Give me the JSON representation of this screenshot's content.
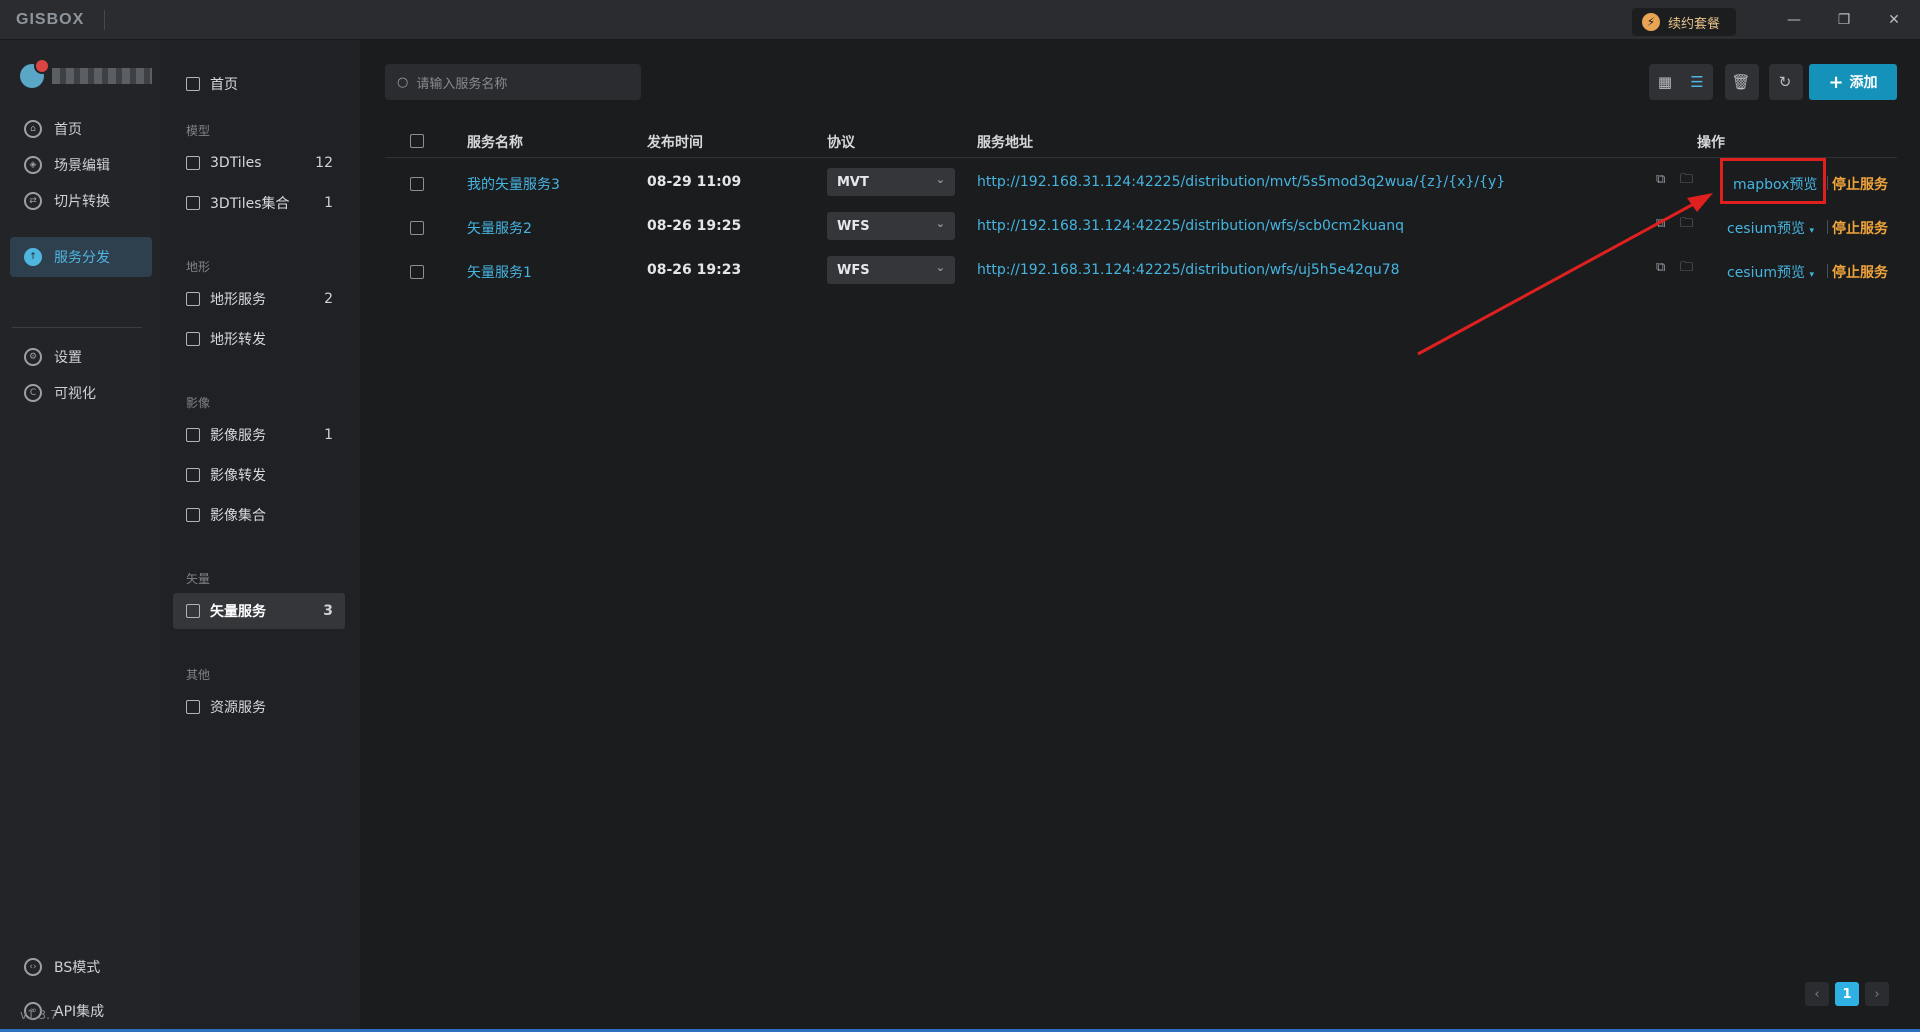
{
  "app": {
    "logo": "GISBOX",
    "renew": "续约套餐",
    "version": "v1.3.7"
  },
  "left_nav": {
    "items": [
      {
        "label": "首页",
        "icon": "home-icon"
      },
      {
        "label": "场景编辑",
        "icon": "cube-icon"
      },
      {
        "label": "切片转换",
        "icon": "swap-icon"
      },
      {
        "label": "服务分发",
        "icon": "upload-icon"
      },
      {
        "label": "设置",
        "icon": "gear-icon"
      },
      {
        "label": "可视化",
        "icon": "chart-icon"
      },
      {
        "label": "BS模式",
        "icon": "code-icon"
      },
      {
        "label": "API集成",
        "icon": "link-icon"
      }
    ]
  },
  "sub_nav": {
    "home": "首页",
    "groups": [
      "模型",
      "地形",
      "影像",
      "矢量",
      "其他"
    ],
    "items": [
      {
        "label": "3DTiles",
        "count": "12"
      },
      {
        "label": "3DTiles集合",
        "count": "1"
      },
      {
        "label": "地形服务",
        "count": "2"
      },
      {
        "label": "地形转发",
        "count": ""
      },
      {
        "label": "影像服务",
        "count": "1"
      },
      {
        "label": "影像转发",
        "count": ""
      },
      {
        "label": "影像集合",
        "count": ""
      },
      {
        "label": "矢量服务",
        "count": "3"
      },
      {
        "label": "资源服务",
        "count": ""
      }
    ]
  },
  "toolbar": {
    "search_placeholder": "请输入服务名称",
    "add_label": "添加"
  },
  "table": {
    "headers": {
      "name": "服务名称",
      "time": "发布时间",
      "protocol": "协议",
      "url": "服务地址",
      "actions": "操作"
    },
    "rows": [
      {
        "name": "我的矢量服务3",
        "time": "08-29 11:09",
        "protocol": "MVT",
        "url": "http://192.168.31.124:42225/distribution/mvt/5s5mod3q2wua/{z}/{x}/{y}",
        "preview": "mapbox预览",
        "stop": "停止服务"
      },
      {
        "name": "矢量服务2",
        "time": "08-26 19:25",
        "protocol": "WFS",
        "url": "http://192.168.31.124:42225/distribution/wfs/scb0cm2kuanq",
        "preview": "cesium预览",
        "stop": "停止服务"
      },
      {
        "name": "矢量服务1",
        "time": "08-26 19:23",
        "protocol": "WFS",
        "url": "http://192.168.31.124:42225/distribution/wfs/uj5h5e42qu78",
        "preview": "cesium预览",
        "stop": "停止服务"
      }
    ]
  },
  "pagination": {
    "current": "1"
  },
  "colors": {
    "accent": "#1592b9",
    "link": "#46b4e0",
    "stop": "#f0a43a",
    "highlight": "#e0201f"
  }
}
